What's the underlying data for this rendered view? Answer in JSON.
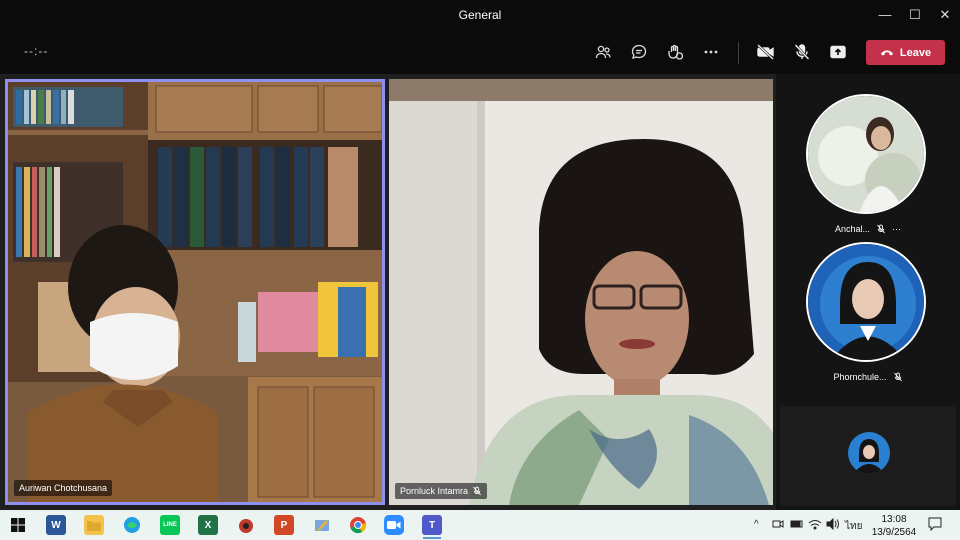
{
  "window": {
    "title": "General",
    "minimize_glyph": "—",
    "maximize_glyph": "☐",
    "close_glyph": "✕"
  },
  "toolbar": {
    "timer": "--:--",
    "icons": [
      "people-icon",
      "chat-icon",
      "reactions-icon",
      "more-icon",
      "camera-off-icon",
      "mic-off-icon",
      "share-icon"
    ],
    "leave_label": "Leave",
    "leave_color": "#c4314b"
  },
  "participants": {
    "main": [
      {
        "name": "Auriwan Chotchusana",
        "active_speaker": true,
        "highlight_color": "#8f8ff0"
      },
      {
        "name": "Pornluck Intamra",
        "muted": true
      }
    ],
    "side": [
      {
        "name": "Anchal...",
        "muted": true,
        "more": "···"
      },
      {
        "name": "Phornchule...",
        "muted": true
      }
    ]
  },
  "taskbar": {
    "apps": [
      {
        "name": "windows-start",
        "label": ""
      },
      {
        "name": "word",
        "label": "W",
        "color": "#2b579a"
      },
      {
        "name": "file-explorer",
        "label": "",
        "color": "#f2c14e"
      },
      {
        "name": "edge",
        "label": "",
        "color": "#1fa0e3"
      },
      {
        "name": "line",
        "label": "LINE",
        "color": "#06c755"
      },
      {
        "name": "excel",
        "label": "X",
        "color": "#217346"
      },
      {
        "name": "app-red",
        "label": "",
        "color": "#c0392b"
      },
      {
        "name": "powerpoint",
        "label": "P",
        "color": "#d24726"
      },
      {
        "name": "paint",
        "label": "",
        "color": "#7aa6d9"
      },
      {
        "name": "chrome",
        "label": "",
        "color": "#db4437"
      },
      {
        "name": "zoom",
        "label": "",
        "color": "#2d8cff"
      },
      {
        "name": "teams",
        "label": "T",
        "color": "#5059c9"
      }
    ],
    "tray": {
      "language": "ไทย",
      "time": "13:08",
      "date": "13/9/2564",
      "caret": "^"
    }
  }
}
